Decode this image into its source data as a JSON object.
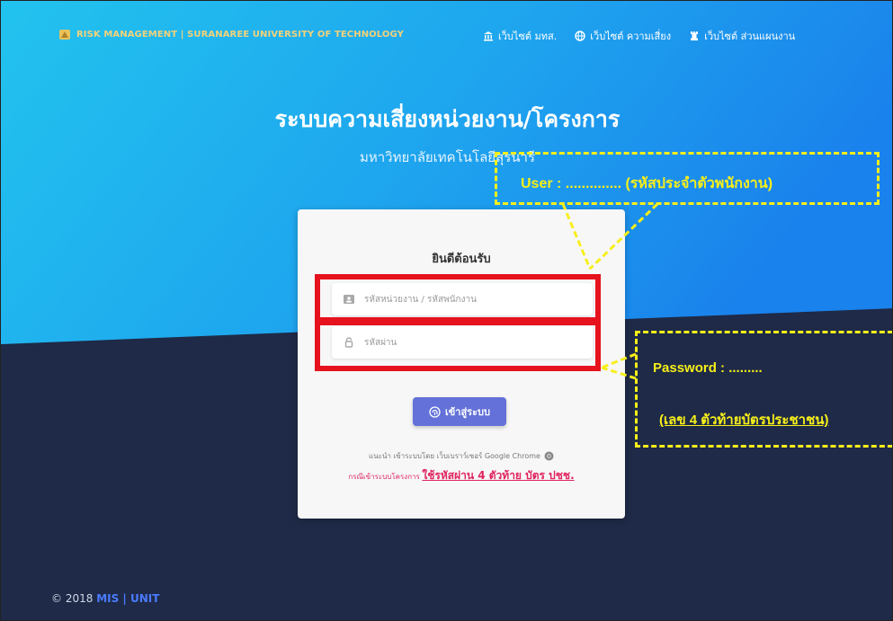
{
  "nav": {
    "brand": "RISK MANAGEMENT | SURANAREE UNIVERSITY OF TECHNOLOGY",
    "links": [
      {
        "label": "เว็บไซต์ มทส.",
        "icon": "bank-icon"
      },
      {
        "label": "เว็บไซต์ ความเสี่ยง",
        "icon": "globe-icon"
      },
      {
        "label": "เว็บไซต์ ส่วนแผนงาน",
        "icon": "chess-rook-icon"
      }
    ]
  },
  "hero": {
    "title": "ระบบความเสี่ยงหน่วยงาน/โครงการ",
    "subtitle": "มหาวิทยาลัยเทคโนโลยีสุรนารี"
  },
  "login": {
    "welcome": "ยินดีต้อนรับ",
    "username_placeholder": "รหัสหน่วยงาน / รหัสพนักงาน",
    "password_placeholder": "รหัสผ่าน",
    "submit_label": "เข้าสู่ระบบ",
    "advice": "แนะนำ เข้าระบบโดย เว็บเบราว์เซอร์ Google Chrome",
    "project_prefix": "กรณีเข้าระบบโครงการ",
    "project_emphasis": "ใช้รหัสผ่าน 4 ตัวท้าย บัตร ปชช."
  },
  "annotations": {
    "user": "User : .............. (รหัสประจำตัวพนักงาน)",
    "password_line1": "Password : .........",
    "password_line2": "(เลข 4 ตัวท้ายบัตรประชาชน)"
  },
  "footer": {
    "copyright": "© 2018",
    "unit": "MIS | UNIT"
  },
  "colors": {
    "accent": "#6371d8",
    "highlight_red": "#e6121d",
    "callout_yellow": "#f7ef1a",
    "hero_blue": "#1ba7ea",
    "navy": "#1e2a47"
  }
}
